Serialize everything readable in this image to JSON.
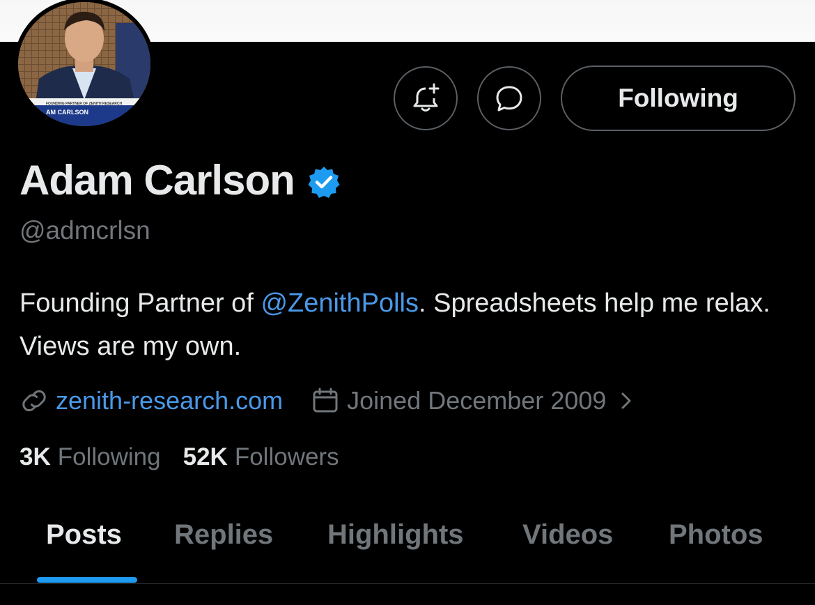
{
  "profile": {
    "display_name": "Adam Carlson",
    "handle": "@admcrlsn",
    "verified": true,
    "avatar_caption": {
      "line1": "FOUNDING PARTNER OF ZENITH RESEARCH",
      "line2": "AM CARLSON"
    }
  },
  "actions": {
    "bell_icon": "bell-plus-icon",
    "message_icon": "message-bubble-icon",
    "follow_label": "Following"
  },
  "bio": {
    "before_mention": "Founding Partner of ",
    "mention": "@ZenithPolls",
    "after_mention": ". Spreadsheets help me relax. Views are my own."
  },
  "meta": {
    "link_icon": "link-icon",
    "website": "zenith-research.com",
    "calendar_icon": "calendar-icon",
    "joined": "Joined December 2009",
    "chevron_icon": "chevron-right-icon"
  },
  "stats": {
    "following_count": "3K",
    "following_label": "Following",
    "followers_count": "52K",
    "followers_label": "Followers"
  },
  "tabs": [
    {
      "label": "Posts",
      "active": true
    },
    {
      "label": "Replies",
      "active": false
    },
    {
      "label": "Highlights",
      "active": false
    },
    {
      "label": "Videos",
      "active": false
    },
    {
      "label": "Photos",
      "active": false
    }
  ],
  "colors": {
    "background": "#000000",
    "primary_text": "#e7e9ea",
    "secondary_text": "#71767b",
    "link": "#4a99e9",
    "accent": "#1d9bf0",
    "border": "#5a5f64"
  }
}
